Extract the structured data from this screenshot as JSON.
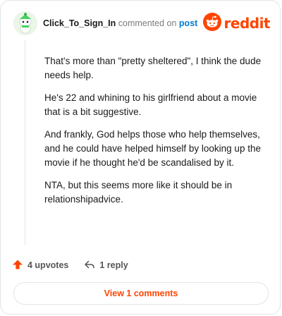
{
  "comment": {
    "username": "Click_To_Sign_In",
    "commented_text": "commented on",
    "post_link": "post",
    "paragraphs": [
      "That's more than \"pretty sheltered\", I think the dude needs help.",
      "He's 22 and whining to his girlfriend about a movie that is a bit suggestive.",
      "And frankly, God helps those who help themselves, and he could have helped himself by looking up the movie if he thought he'd be scandalised by it.",
      "NTA, but this seems more like it should be in relationshipadvice."
    ]
  },
  "brand": {
    "name": "reddit",
    "color": "#ff4500"
  },
  "actions": {
    "upvotes": "4 upvotes",
    "replies": "1 reply",
    "upvote_icon_color": "#ff4500"
  },
  "view_comments": {
    "label": "View 1 comments",
    "color": "#ff4500"
  },
  "icons": {
    "avatar": "snoo-avatar-icon",
    "brand": "reddit-logo-icon",
    "upvote": "upvote-arrow-icon",
    "reply": "reply-icon"
  }
}
